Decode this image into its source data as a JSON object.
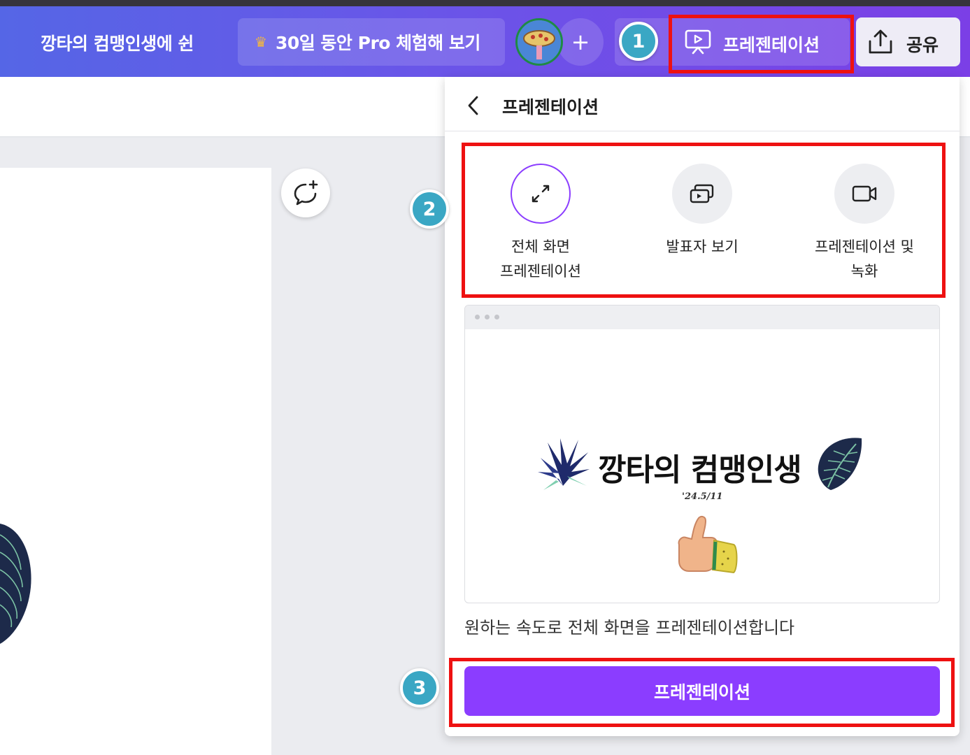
{
  "header": {
    "doc_title": "깡타의 컴맹인생에 쉰",
    "pro_trial_label": "30일 동안 Pro 체험해 보기",
    "present_label": "프레젠테이션",
    "share_label": "공유",
    "add_label": "+"
  },
  "panel": {
    "title": "프레젠테이션",
    "modes": [
      {
        "label": "전체 화면\n프레젠테이션",
        "icon": "expand-icon",
        "selected": true
      },
      {
        "label": "발표자 보기",
        "icon": "presenter-view-icon",
        "selected": false
      },
      {
        "label": "프레젠테이션 및\n녹화",
        "icon": "video-camera-icon",
        "selected": false
      }
    ],
    "preview": {
      "slide_title": "깡타의 컴맹인생",
      "slide_date": "'24.5/11"
    },
    "description": "원하는 속도로 전체 화면을 프레젠테이션합니다",
    "present_button": "프레젠테이션"
  },
  "annotations": {
    "step1": "1",
    "step2": "2",
    "step3": "3",
    "highlight_color": "#ee1111",
    "badge_color": "#3aa7c4"
  },
  "colors": {
    "accent": "#8b3dff",
    "topbar_start": "#5566e6",
    "topbar_end": "#7b3fe6"
  }
}
